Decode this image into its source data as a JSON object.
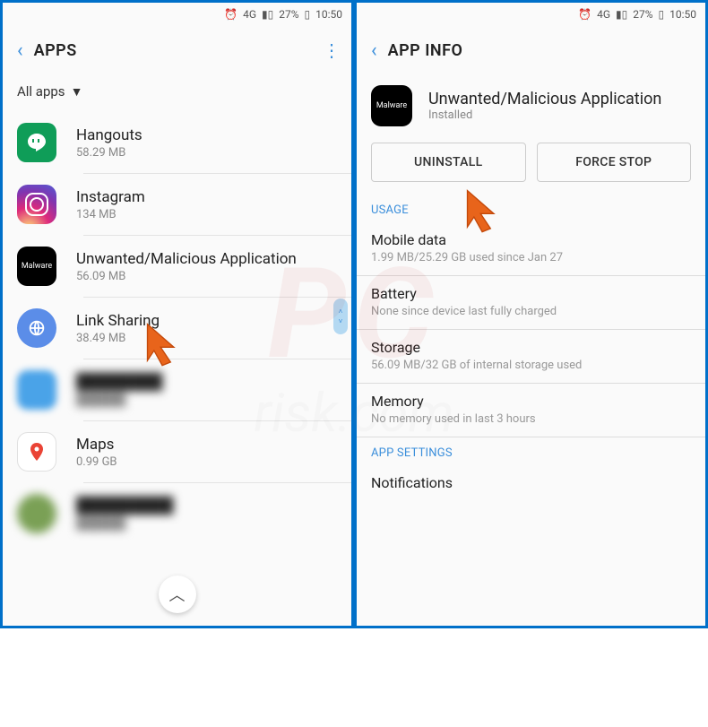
{
  "status": {
    "network": "4G",
    "battery": "27%",
    "time": "10:50"
  },
  "left": {
    "title": "APPS",
    "filter": "All apps",
    "apps": [
      {
        "name": "Hangouts",
        "size": "58.29 MB"
      },
      {
        "name": "Instagram",
        "size": "134 MB"
      },
      {
        "name": "Unwanted/Malicious Application",
        "size": "56.09 MB"
      },
      {
        "name": "Link Sharing",
        "size": "38.49 MB"
      },
      {
        "name": "___",
        "size": "___"
      },
      {
        "name": "Maps",
        "size": "0.99 GB"
      },
      {
        "name": "___",
        "size": "___"
      }
    ]
  },
  "right": {
    "title": "APP INFO",
    "app_name": "Unwanted/Malicious Application",
    "app_status": "Installed",
    "uninstall": "UNINSTALL",
    "force_stop": "FORCE STOP",
    "usage_label": "USAGE",
    "mobile_data": {
      "title": "Mobile data",
      "sub": "1.99 MB/25.29 GB used since Jan 27"
    },
    "battery": {
      "title": "Battery",
      "sub": "None since device last fully charged"
    },
    "storage": {
      "title": "Storage",
      "sub": "56.09 MB/32 GB of internal storage used"
    },
    "memory": {
      "title": "Memory",
      "sub": "No memory used in last 3 hours"
    },
    "app_settings_label": "APP SETTINGS",
    "notifications": "Notifications"
  },
  "malware_label": "Malware"
}
